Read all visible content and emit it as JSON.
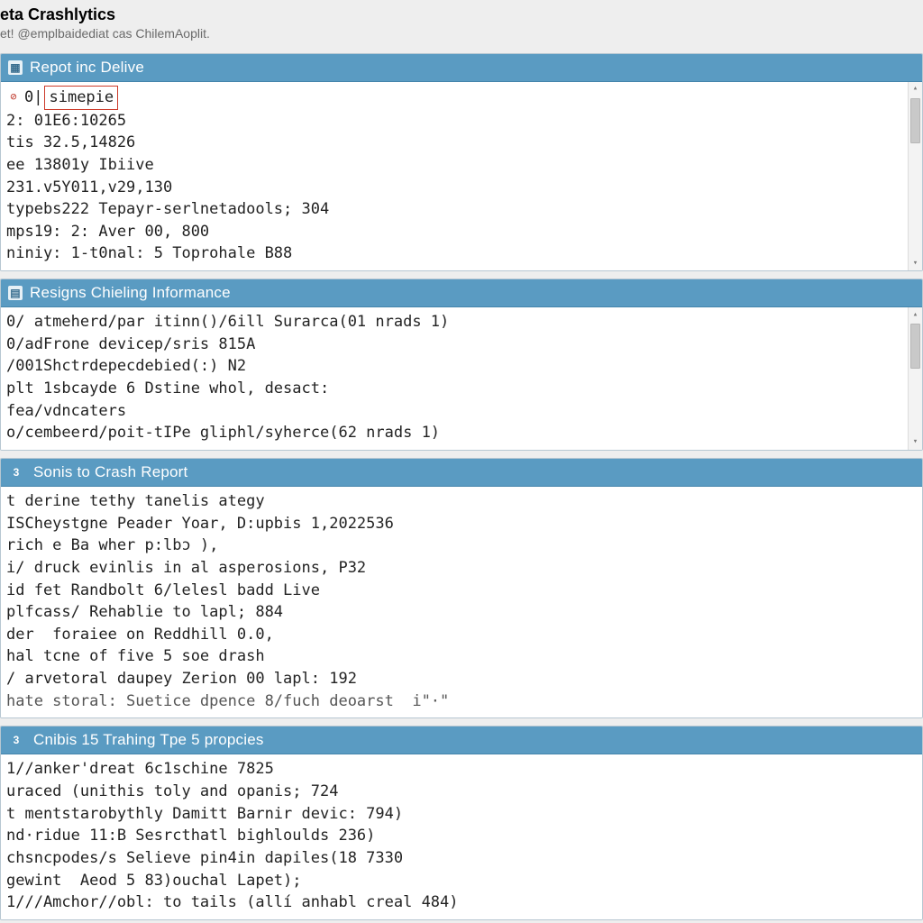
{
  "header": {
    "title": "eta Crashlytics",
    "subtitle": "et! @emplbaidediat cas ChilemAoplit."
  },
  "panels": [
    {
      "id": "report-delive",
      "icon_badge": "",
      "icon_glyph": "▦",
      "title": "Repot inc Delive",
      "has_scroll": true,
      "lines": [
        {
          "id": "l0",
          "prefix_icon": "⊘",
          "prefix": "0|",
          "highlight": "simepie",
          "rest": ""
        },
        {
          "id": "l1",
          "text": "2: 01E6:10265"
        },
        {
          "id": "l2",
          "text": "tis 32.5,14826"
        },
        {
          "id": "l3",
          "text": "ee 13801y Ibiive"
        },
        {
          "id": "l4",
          "text": "231.v5Y011,v29,130"
        },
        {
          "id": "l5",
          "text": "typebs222 Tepayr-serlnetadools; 304"
        },
        {
          "id": "l6",
          "text": "mps19: 2: Aver 00, 800"
        },
        {
          "id": "l7",
          "text": "niniy: 1-t0nal: 5 Toprohale B88"
        }
      ]
    },
    {
      "id": "resigns-chieling",
      "icon_badge": "",
      "icon_glyph": "▤",
      "title": "Resigns Chieling Informance",
      "has_scroll": true,
      "lines": [
        {
          "id": "r0",
          "text": "0/ atmeherd/par itinn()/6ill Surarca(01 nrads 1)"
        },
        {
          "id": "r1",
          "text": "0/adFrone devicep/sris 815A"
        },
        {
          "id": "r2",
          "text": "/001Shctrdepecdebied(:) N2"
        },
        {
          "id": "r3",
          "text": "plt 1sbcayde 6 Dstine whol, desact:"
        },
        {
          "id": "r4",
          "text": "fea/vdncaters"
        },
        {
          "id": "r5",
          "text": "o/cembeerd/poit-tIPe gliphl/syherce(62 nrads 1)"
        }
      ]
    },
    {
      "id": "sonis-crash",
      "icon_badge": "3",
      "icon_glyph": "",
      "title": "Sonis to Crash Report",
      "has_scroll": false,
      "lines": [
        {
          "id": "s0",
          "text": "t derine tethy tanelis ategy"
        },
        {
          "id": "s1",
          "text": "ISCheystgne Peader Yoar, D:upbis 1,2022536"
        },
        {
          "id": "s2",
          "text": "rich e Ba wher p:lbɔ ),"
        },
        {
          "id": "s3",
          "text": "i/ druck evinlis in al asperosions, P32"
        },
        {
          "id": "s4",
          "text": "id fet Randbolt 6/lelesl badd Live"
        },
        {
          "id": "s5",
          "text": "plfcass/ Rehablie to lapl; 884"
        },
        {
          "id": "s6",
          "text": "der  foraiee on Reddhill 0.0,"
        },
        {
          "id": "s7",
          "text": "hal tcne of five 5 soe drash"
        },
        {
          "id": "s8",
          "text": "/ arvetoral daupey Zerion 00 lapl: 192"
        },
        {
          "id": "s9",
          "text": "hate storal: Suetice dpence 8/fuch deoarst  i\"·\""
        }
      ]
    },
    {
      "id": "cnibis-trahing",
      "icon_badge": "3",
      "icon_glyph": "",
      "title": "Cnibis 15 Trahing Tpe 5 propcies",
      "has_scroll": false,
      "lines": [
        {
          "id": "c0",
          "text": "1//anker'dreat 6c1schine 7825"
        },
        {
          "id": "c1",
          "text": "uraced (unithis toly and opanis; 724"
        },
        {
          "id": "c2",
          "text": "t mentstarobythly Damitt Barnir devic: 794)"
        },
        {
          "id": "c3",
          "text": "nd·ridue 11:B Sesrcthatl bighloulds 236)"
        },
        {
          "id": "c4",
          "text": "chsncpodes/s Selieve pin4in dapiles(18 7330"
        },
        {
          "id": "c5",
          "text": "gewint  Aeod 5 83)ouchal Lapet);"
        },
        {
          "id": "c6",
          "text": "1///Amchor//obl: to tails (allí anhabl creal 484)"
        }
      ]
    }
  ]
}
